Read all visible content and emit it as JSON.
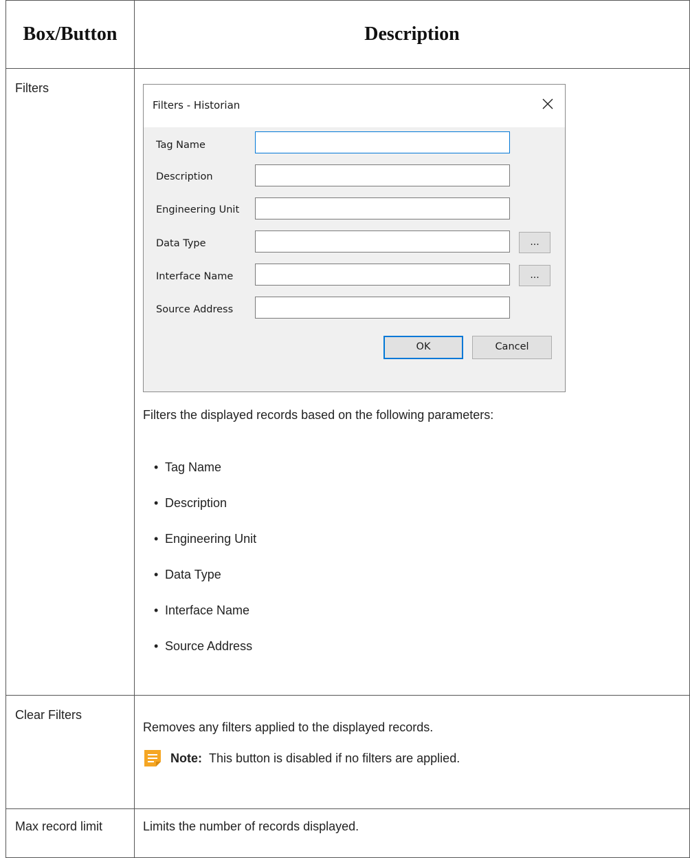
{
  "table": {
    "headers": [
      "Box/Button",
      "Description"
    ],
    "rows": [
      {
        "name": "Filters",
        "dialog": {
          "title": "Filters - Historian",
          "fields": [
            {
              "label": "Tag Name",
              "value": ""
            },
            {
              "label": "Description",
              "value": ""
            },
            {
              "label": "Engineering Unit",
              "value": ""
            },
            {
              "label": "Data Type",
              "value": ""
            },
            {
              "label": "Interface Name",
              "value": ""
            },
            {
              "label": "Source Address",
              "value": ""
            }
          ],
          "browse_label": "...",
          "ok_label": "OK",
          "cancel_label": "Cancel"
        },
        "intro": "Filters the displayed records based on the following parameters:",
        "bullets": [
          "Tag Name",
          "Description",
          "Engineering Unit",
          "Data Type",
          "Interface Name",
          "Source Address"
        ]
      },
      {
        "name": "Clear Filters",
        "text": "Removes any filters applied to the displayed records.",
        "note_label": "Note:",
        "note_text": "This button is disabled if no filters are applied.",
        "note_icon": "note-icon",
        "note_color": "#f5a623"
      },
      {
        "name": "Max record limit",
        "text": "Limits the number of records displayed."
      }
    ]
  }
}
